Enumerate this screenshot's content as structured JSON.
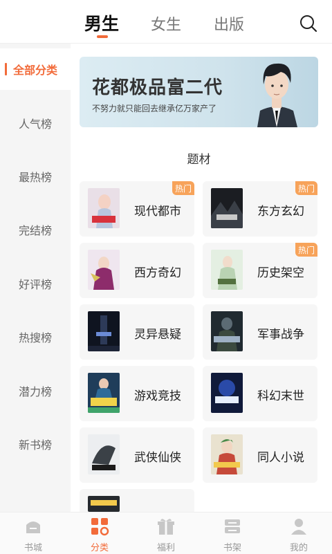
{
  "header": {
    "tabs": [
      {
        "label": "男生",
        "active": true
      },
      {
        "label": "女生",
        "active": false
      },
      {
        "label": "出版",
        "active": false
      }
    ],
    "search_icon": "search-icon"
  },
  "sidebar": {
    "items": [
      {
        "label": "全部分类",
        "active": true
      },
      {
        "label": "人气榜"
      },
      {
        "label": "最热榜"
      },
      {
        "label": "完结榜"
      },
      {
        "label": "好评榜"
      },
      {
        "label": "热搜榜"
      },
      {
        "label": "潜力榜"
      },
      {
        "label": "新书榜"
      }
    ]
  },
  "banner": {
    "title": "花都极品富二代",
    "subtitle": "不努力就只能回去继承亿万家产了"
  },
  "section": {
    "title": "题材"
  },
  "categories": [
    {
      "label": "现代都市",
      "hot": "热门"
    },
    {
      "label": "东方玄幻",
      "hot": "热门"
    },
    {
      "label": "西方奇幻",
      "hot": ""
    },
    {
      "label": "历史架空",
      "hot": "热门"
    },
    {
      "label": "灵异悬疑",
      "hot": ""
    },
    {
      "label": "军事战争",
      "hot": ""
    },
    {
      "label": "游戏竞技",
      "hot": ""
    },
    {
      "label": "科幻末世",
      "hot": ""
    },
    {
      "label": "武侠仙侠",
      "hot": ""
    },
    {
      "label": "同人小说",
      "hot": ""
    },
    {
      "label": "",
      "hot": ""
    }
  ],
  "bottom_nav": [
    {
      "label": "书城",
      "icon": "bookstore-icon"
    },
    {
      "label": "分类",
      "icon": "category-icon",
      "active": true
    },
    {
      "label": "福利",
      "icon": "gift-icon"
    },
    {
      "label": "书架",
      "icon": "bookshelf-icon"
    },
    {
      "label": "我的",
      "icon": "profile-icon"
    }
  ],
  "colors": {
    "accent": "#f26b3a",
    "hot_badge": "#f7a35a",
    "sidebar_bg": "#f5f5f5",
    "card_bg": "#f6f6f6"
  }
}
